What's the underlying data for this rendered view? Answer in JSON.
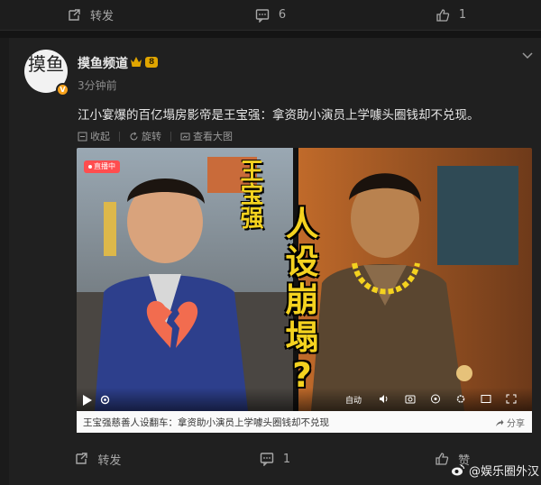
{
  "top_actions": {
    "repost_label": "转发",
    "comment_count": "6",
    "like_count": "1"
  },
  "post": {
    "username": "摸鱼频道",
    "level_badge": "8",
    "time": "3分钟前",
    "avatar_text": "摸鱼",
    "text": "江小宴爆的百亿塌房影帝是王宝强：拿资助小演员上学噱头圈钱却不兑现。",
    "tools": {
      "collapse": "收起",
      "rotate": "旋转",
      "view_large": "查看大图"
    }
  },
  "video": {
    "live_tag": "直播中",
    "name_title": "王宝强",
    "headline": [
      "人",
      "设",
      "崩",
      "塌",
      "?"
    ],
    "control_label": "自动",
    "caption": "王宝强慈善人设翻车：拿资助小演员上学噱头圈钱却不兑现",
    "share_label": "分享"
  },
  "bottom_actions": {
    "repost_label": "转发",
    "comment_count": "1",
    "like_label": "赞"
  },
  "watermark": "@娱乐圈外汉",
  "colors": {
    "accent_yellow": "#f4d21f",
    "heart_red": "#f26c4f",
    "badge_orange": "#f7a21b"
  }
}
